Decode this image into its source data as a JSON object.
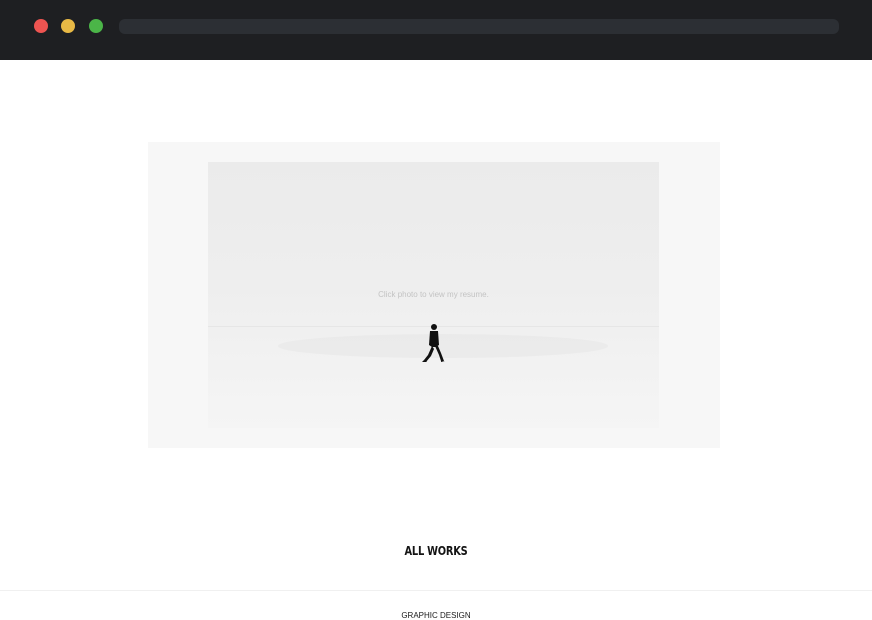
{
  "window": {
    "controls": [
      "close",
      "minimize",
      "maximize"
    ],
    "colors": {
      "close": "#ee5451",
      "minimize": "#e8b945",
      "maximize": "#4bb548",
      "chrome": "#1e1f22"
    }
  },
  "hero": {
    "caption": "Click photo to view my resume.",
    "figure_icon": "walking-person-icon"
  },
  "works": {
    "title": "ALL WORKS",
    "category": "GRAPHIC DESIGN"
  }
}
